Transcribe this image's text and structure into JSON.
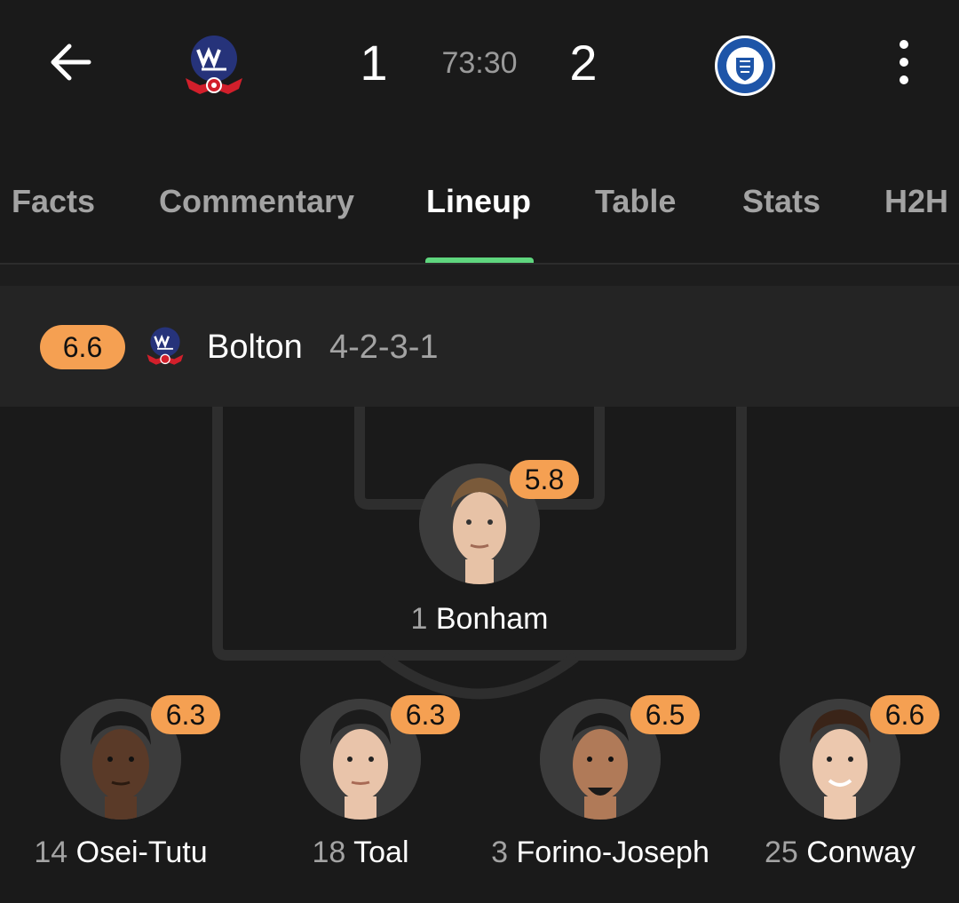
{
  "match": {
    "home_score": "1",
    "clock": "73:30",
    "away_score": "2"
  },
  "tabs": [
    "Facts",
    "Commentary",
    "Lineup",
    "Table",
    "Stats",
    "H2H"
  ],
  "active_tab": "Lineup",
  "team": {
    "rating": "6.6",
    "name": "Bolton",
    "formation": "4-2-3-1"
  },
  "players": [
    {
      "number": "1",
      "name": "Bonham",
      "rating": "5.8"
    },
    {
      "number": "14",
      "name": "Osei-Tutu",
      "rating": "6.3"
    },
    {
      "number": "18",
      "name": "Toal",
      "rating": "6.3"
    },
    {
      "number": "3",
      "name": "Forino-Joseph",
      "rating": "6.5"
    },
    {
      "number": "25",
      "name": "Conway",
      "rating": "6.6"
    }
  ],
  "colors": {
    "background": "#1a1a1a",
    "rating_badge": "#f5a052",
    "tab_indicator": "#5fd67e",
    "muted_text": "#a3a3a3"
  },
  "icons": {
    "back": "arrow-left-icon",
    "more": "more-vertical-icon",
    "home_crest": "bolton-crest",
    "away_crest": "stockport-crest"
  }
}
